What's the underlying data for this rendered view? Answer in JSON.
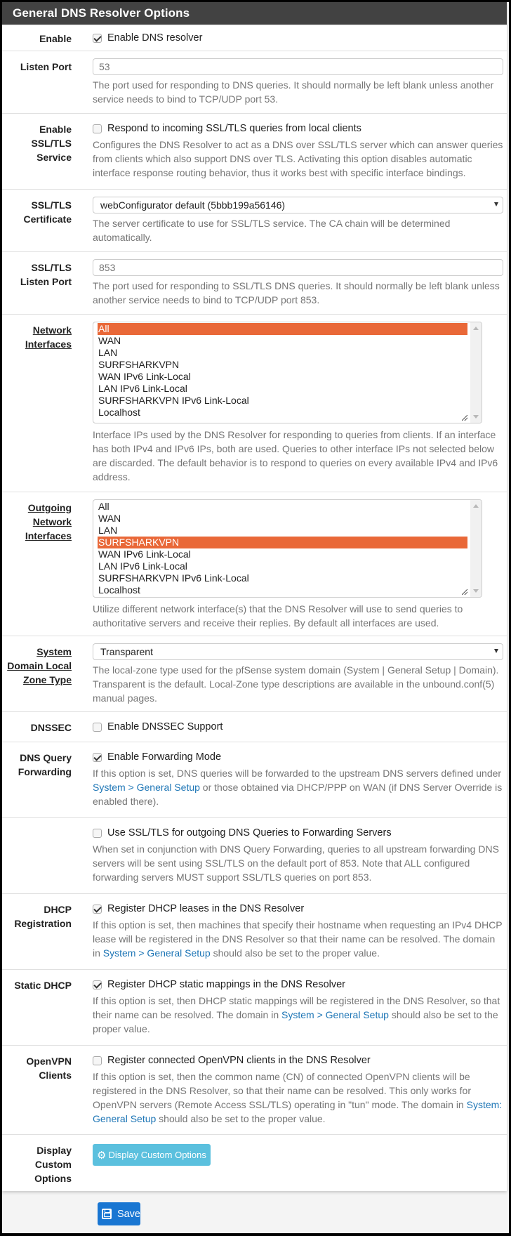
{
  "panel": {
    "title": "General DNS Resolver Options"
  },
  "enable": {
    "label": "Enable",
    "checkbox_label": "Enable DNS resolver",
    "checked": true
  },
  "listen_port": {
    "label": "Listen Port",
    "placeholder": "53",
    "value": "",
    "help": "The port used for responding to DNS queries. It should normally be left blank unless another service needs to bind to TCP/UDP port 53."
  },
  "ssl_service": {
    "label": "Enable SSL/TLS Service",
    "checkbox_label": "Respond to incoming SSL/TLS queries from local clients",
    "checked": false,
    "help": "Configures the DNS Resolver to act as a DNS over SSL/TLS server which can answer queries from clients which also support DNS over TLS. Activating this option disables automatic interface response routing behavior, thus it works best with specific interface bindings."
  },
  "ssl_cert": {
    "label": "SSL/TLS Certificate",
    "selected": "webConfigurator default (5bbb199a56146)",
    "help": "The server certificate to use for SSL/TLS service. The CA chain will be determined automatically."
  },
  "ssl_port": {
    "label": "SSL/TLS Listen Port",
    "placeholder": "853",
    "value": "",
    "help": "The port used for responding to SSL/TLS DNS queries. It should normally be left blank unless another service needs to bind to TCP/UDP port 853."
  },
  "network_interfaces": {
    "label": "Network Interfaces",
    "options": [
      "All",
      "WAN",
      "LAN",
      "SURFSHARKVPN",
      "WAN IPv6 Link-Local",
      "LAN IPv6 Link-Local",
      "SURFSHARKVPN IPv6 Link-Local",
      "Localhost"
    ],
    "selected": [
      "All"
    ],
    "help": "Interface IPs used by the DNS Resolver for responding to queries from clients. If an interface has both IPv4 and IPv6 IPs, both are used. Queries to other interface IPs not selected below are discarded. The default behavior is to respond to queries on every available IPv4 and IPv6 address."
  },
  "outgoing_interfaces": {
    "label": "Outgoing Network Interfaces",
    "options": [
      "All",
      "WAN",
      "LAN",
      "SURFSHARKVPN",
      "WAN IPv6 Link-Local",
      "LAN IPv6 Link-Local",
      "SURFSHARKVPN IPv6 Link-Local",
      "Localhost"
    ],
    "selected": [
      "SURFSHARKVPN"
    ],
    "help": "Utilize different network interface(s) that the DNS Resolver will use to send queries to authoritative servers and receive their replies. By default all interfaces are used."
  },
  "zone_type": {
    "label": "System Domain Local Zone Type",
    "selected": "Transparent",
    "help": "The local-zone type used for the pfSense system domain (System | General Setup | Domain). Transparent is the default. Local-Zone type descriptions are available in the unbound.conf(5) manual pages."
  },
  "dnssec": {
    "label": "DNSSEC",
    "checkbox_label": "Enable DNSSEC Support",
    "checked": false
  },
  "forwarding": {
    "label": "DNS Query Forwarding",
    "checkbox_label": "Enable Forwarding Mode",
    "checked": true,
    "help_link": "System > General Setup",
    "help_after": " or those obtained via DHCP/PPP on WAN (if DNS Server Override is enabled there).",
    "help_before": "If this option is set, DNS queries will be forwarded to the upstream DNS servers defined under "
  },
  "ssl_forwarding": {
    "checkbox_label": "Use SSL/TLS for outgoing DNS Queries to Forwarding Servers",
    "checked": false,
    "help": "When set in conjunction with DNS Query Forwarding, queries to all upstream forwarding DNS servers will be sent using SSL/TLS on the default port of 853. Note that ALL configured forwarding servers MUST support SSL/TLS queries on port 853."
  },
  "dhcp_registration": {
    "label": "DHCP Registration",
    "checkbox_label": "Register DHCP leases in the DNS Resolver",
    "checked": true,
    "help_before": "If this option is set, then machines that specify their hostname when requesting an IPv4 DHCP lease will be registered in the DNS Resolver so that their name can be resolved. The domain in ",
    "help_link": "System > General Setup",
    "help_after": " should also be set to the proper value."
  },
  "static_dhcp": {
    "label": "Static DHCP",
    "checkbox_label": "Register DHCP static mappings in the DNS Resolver",
    "checked": true,
    "help_before": "If this option is set, then DHCP static mappings will be registered in the DNS Resolver, so that their name can be resolved. The domain in ",
    "help_link": "System > General Setup",
    "help_after": " should also be set to the proper value."
  },
  "openvpn_clients": {
    "label": "OpenVPN Clients",
    "checkbox_label": "Register connected OpenVPN clients in the DNS Resolver",
    "checked": false,
    "help_before": "If this option is set, then the common name (CN) of connected OpenVPN clients will be registered in the DNS Resolver, so that their name can be resolved. This only works for OpenVPN servers (Remote Access SSL/TLS) operating in \"tun\" mode. The domain in ",
    "help_link": "System: General Setup",
    "help_after": " should also be set to the proper value."
  },
  "custom_options": {
    "label": "Display Custom Options",
    "button_label": "Display Custom Options",
    "icon": "gear-icon"
  },
  "save": {
    "label": "Save",
    "icon": "floppy-icon"
  },
  "colors": {
    "header_bg": "#424242",
    "selected_option": "#e96838",
    "link": "#1e76b6",
    "info_button": "#5bc0de",
    "save_button": "#1976d2"
  }
}
